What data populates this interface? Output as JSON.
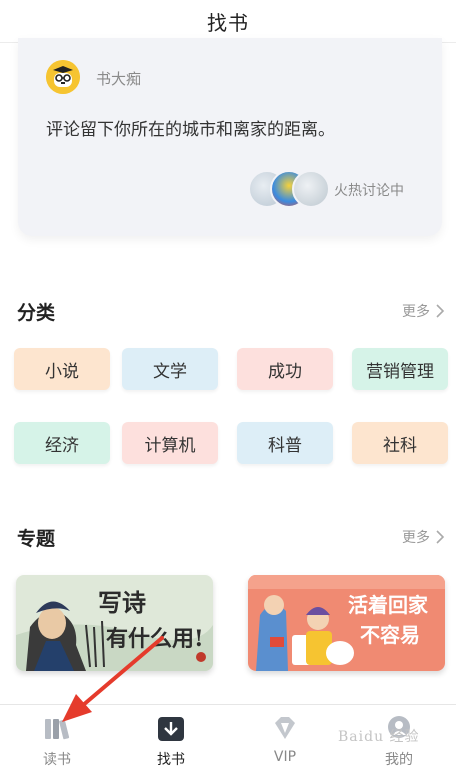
{
  "header": {
    "title": "找书"
  },
  "discussion": {
    "username": "书大痴",
    "text": "评论留下你所在的城市和离家的距离。",
    "hot_label": "火热讨论中"
  },
  "categories": {
    "title": "分类",
    "more_label": "更多",
    "items": [
      {
        "label": "小说",
        "color": "#fde5cf"
      },
      {
        "label": "文学",
        "color": "#ddeef7"
      },
      {
        "label": "成功",
        "color": "#fde0dd"
      },
      {
        "label": "营销管理",
        "color": "#d6f3e8"
      },
      {
        "label": "经济",
        "color": "#d6f3e8"
      },
      {
        "label": "计算机",
        "color": "#fde0dd"
      },
      {
        "label": "科普",
        "color": "#ddeef7"
      },
      {
        "label": "社科",
        "color": "#fde5cf"
      }
    ]
  },
  "topics": {
    "title": "专题",
    "more_label": "更多",
    "banners": [
      {
        "text_line1": "写诗",
        "text_line2": "有什么用!"
      },
      {
        "text_line1": "活着回家",
        "text_line2": "不容易"
      }
    ]
  },
  "tabbar": {
    "items": [
      {
        "label": "读书",
        "icon": "bookshelf-icon"
      },
      {
        "label": "找书",
        "icon": "download-book-icon",
        "active": true
      },
      {
        "label": "VIP",
        "icon": "diamond-icon"
      },
      {
        "label": "我的",
        "icon": "profile-icon"
      }
    ]
  },
  "watermark": {
    "text": "Baidu 经验"
  },
  "accent_color": "#e53b2c"
}
